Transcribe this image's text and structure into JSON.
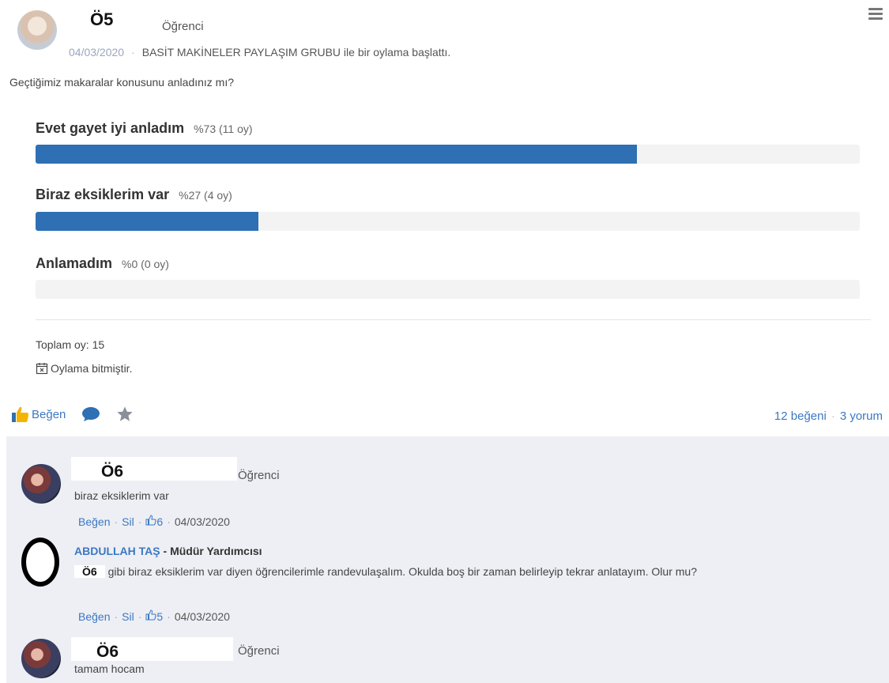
{
  "post": {
    "author": "Ö5",
    "author_role": "Öğrenci",
    "date": "04/03/2020",
    "action_text": "BASİT MAKİNELER PAYLAŞIM GRUBU ile bir oylama başlattı.",
    "question": "Geçtiğimiz makaralar konusunu anladınız mı?",
    "options": [
      {
        "label": "Evet gayet iyi anladım",
        "stat": "%73 (11 oy)",
        "percent": 73
      },
      {
        "label": "Biraz eksiklerim var",
        "stat": "%27 (4 oy)",
        "percent": 27
      },
      {
        "label": "Anlamadım",
        "stat": "%0 (0 oy)",
        "percent": 0
      }
    ],
    "total_votes": "Toplam oy: 15",
    "ended_text": "Oylama bitmiştir.",
    "like_label": "Beğen",
    "likes_count": "12 beğeni",
    "comments_count": "3 yorum"
  },
  "comments": [
    {
      "author": "Ö6",
      "role": "Öğrenci",
      "text": "biraz eksiklerim var",
      "like": "Beğen",
      "delete": "Sil",
      "likes": "6",
      "date": "04/03/2020"
    },
    {
      "author": "ABDULLAH TAŞ",
      "role": "Müdür Yardımcısı",
      "mention": "Ö6",
      "text": "gibi biraz eksiklerim var diyen öğrencilerimle randevulaşalım. Okulda boş bir zaman belirleyip tekrar anlatayım. Olur mu?",
      "like": "Beğen",
      "delete": "Sil",
      "likes": "5",
      "date": "04/03/2020"
    },
    {
      "author": "Ö6",
      "role": "Öğrenci",
      "text": "tamam hocam"
    }
  ],
  "colors": {
    "accent": "#3c78c3",
    "bar": "#2f6fb3",
    "comments_bg": "#edeff4"
  }
}
